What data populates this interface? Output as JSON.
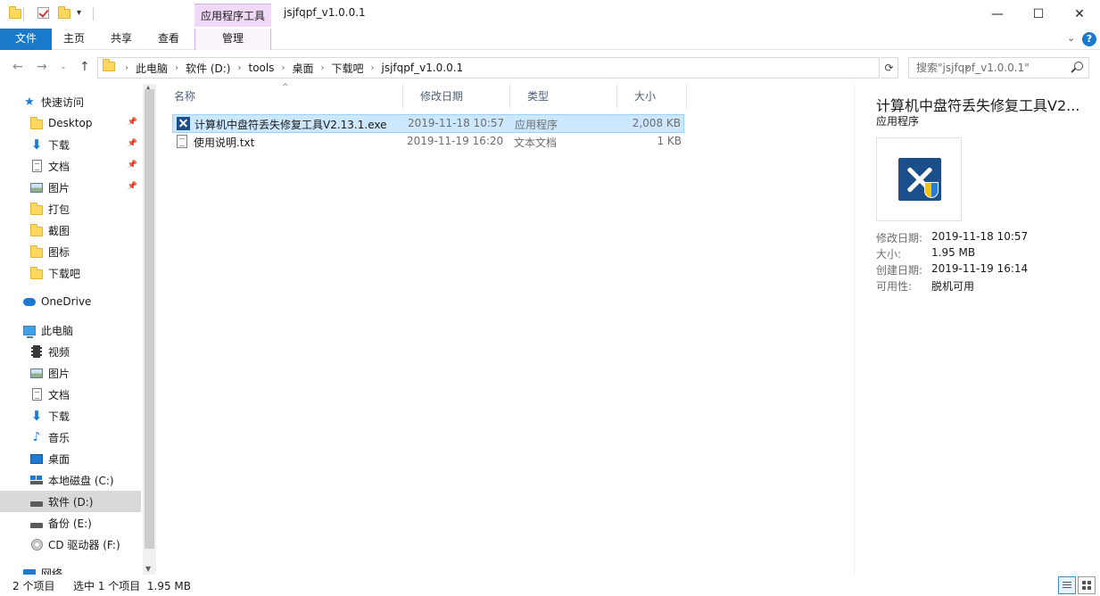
{
  "window": {
    "title": "jsjfqpf_v1.0.0.1",
    "contextual_tab_group": "应用程序工具",
    "minimize_glyph": "—",
    "maximize_glyph": "☐",
    "close_glyph": "✕"
  },
  "ribbon": {
    "tabs": [
      {
        "label": "文件"
      },
      {
        "label": "主页"
      },
      {
        "label": "共享"
      },
      {
        "label": "查看"
      },
      {
        "label": "管理"
      }
    ],
    "expand_glyph": "⌄",
    "help_glyph": "?"
  },
  "address": {
    "crumbs": [
      "此电脑",
      "软件 (D:)",
      "tools",
      "桌面",
      "下载吧",
      "jsjfqpf_v1.0.0.1"
    ],
    "search_placeholder": "搜索\"jsjfqpf_v1.0.0.1\""
  },
  "nav": {
    "quick_access": "快速访问",
    "pinned": [
      "Desktop",
      "下载",
      "文档",
      "图片"
    ],
    "folders": [
      "打包",
      "截图",
      "图标",
      "下载吧"
    ],
    "onedrive": "OneDrive",
    "this_pc": "此电脑",
    "pc_items": [
      "视频",
      "图片",
      "文档",
      "下载",
      "音乐",
      "桌面"
    ],
    "drives": [
      "本地磁盘 (C:)",
      "软件 (D:)",
      "备份 (E:)",
      "CD 驱动器 (F:)"
    ],
    "network": "网络"
  },
  "columns": {
    "name": "名称",
    "modified": "修改日期",
    "type": "类型",
    "size": "大小"
  },
  "files": [
    {
      "name": "计算机中盘符丢失修复工具V2.13.1.exe",
      "modified": "2019-11-18 10:57",
      "type": "应用程序",
      "size": "2,008 KB",
      "selected": true
    },
    {
      "name": "使用说明.txt",
      "modified": "2019-11-19 16:20",
      "type": "文本文档",
      "size": "1 KB",
      "selected": false
    }
  ],
  "details": {
    "title": "计算机中盘符丢失修复工具V2...",
    "subtitle": "应用程序",
    "props": [
      {
        "label": "修改日期:",
        "value": "2019-11-18 10:57"
      },
      {
        "label": "大小:",
        "value": "1.95 MB"
      },
      {
        "label": "创建日期:",
        "value": "2019-11-19 16:14"
      },
      {
        "label": "可用性:",
        "value": "脱机可用"
      }
    ]
  },
  "status": {
    "item_count": "2 个项目",
    "selection": "选中 1 个项目  1.95 MB"
  },
  "colors": {
    "accent": "#1979ca",
    "selection": "#cce8ff",
    "contextual": "#f0d9f7"
  }
}
